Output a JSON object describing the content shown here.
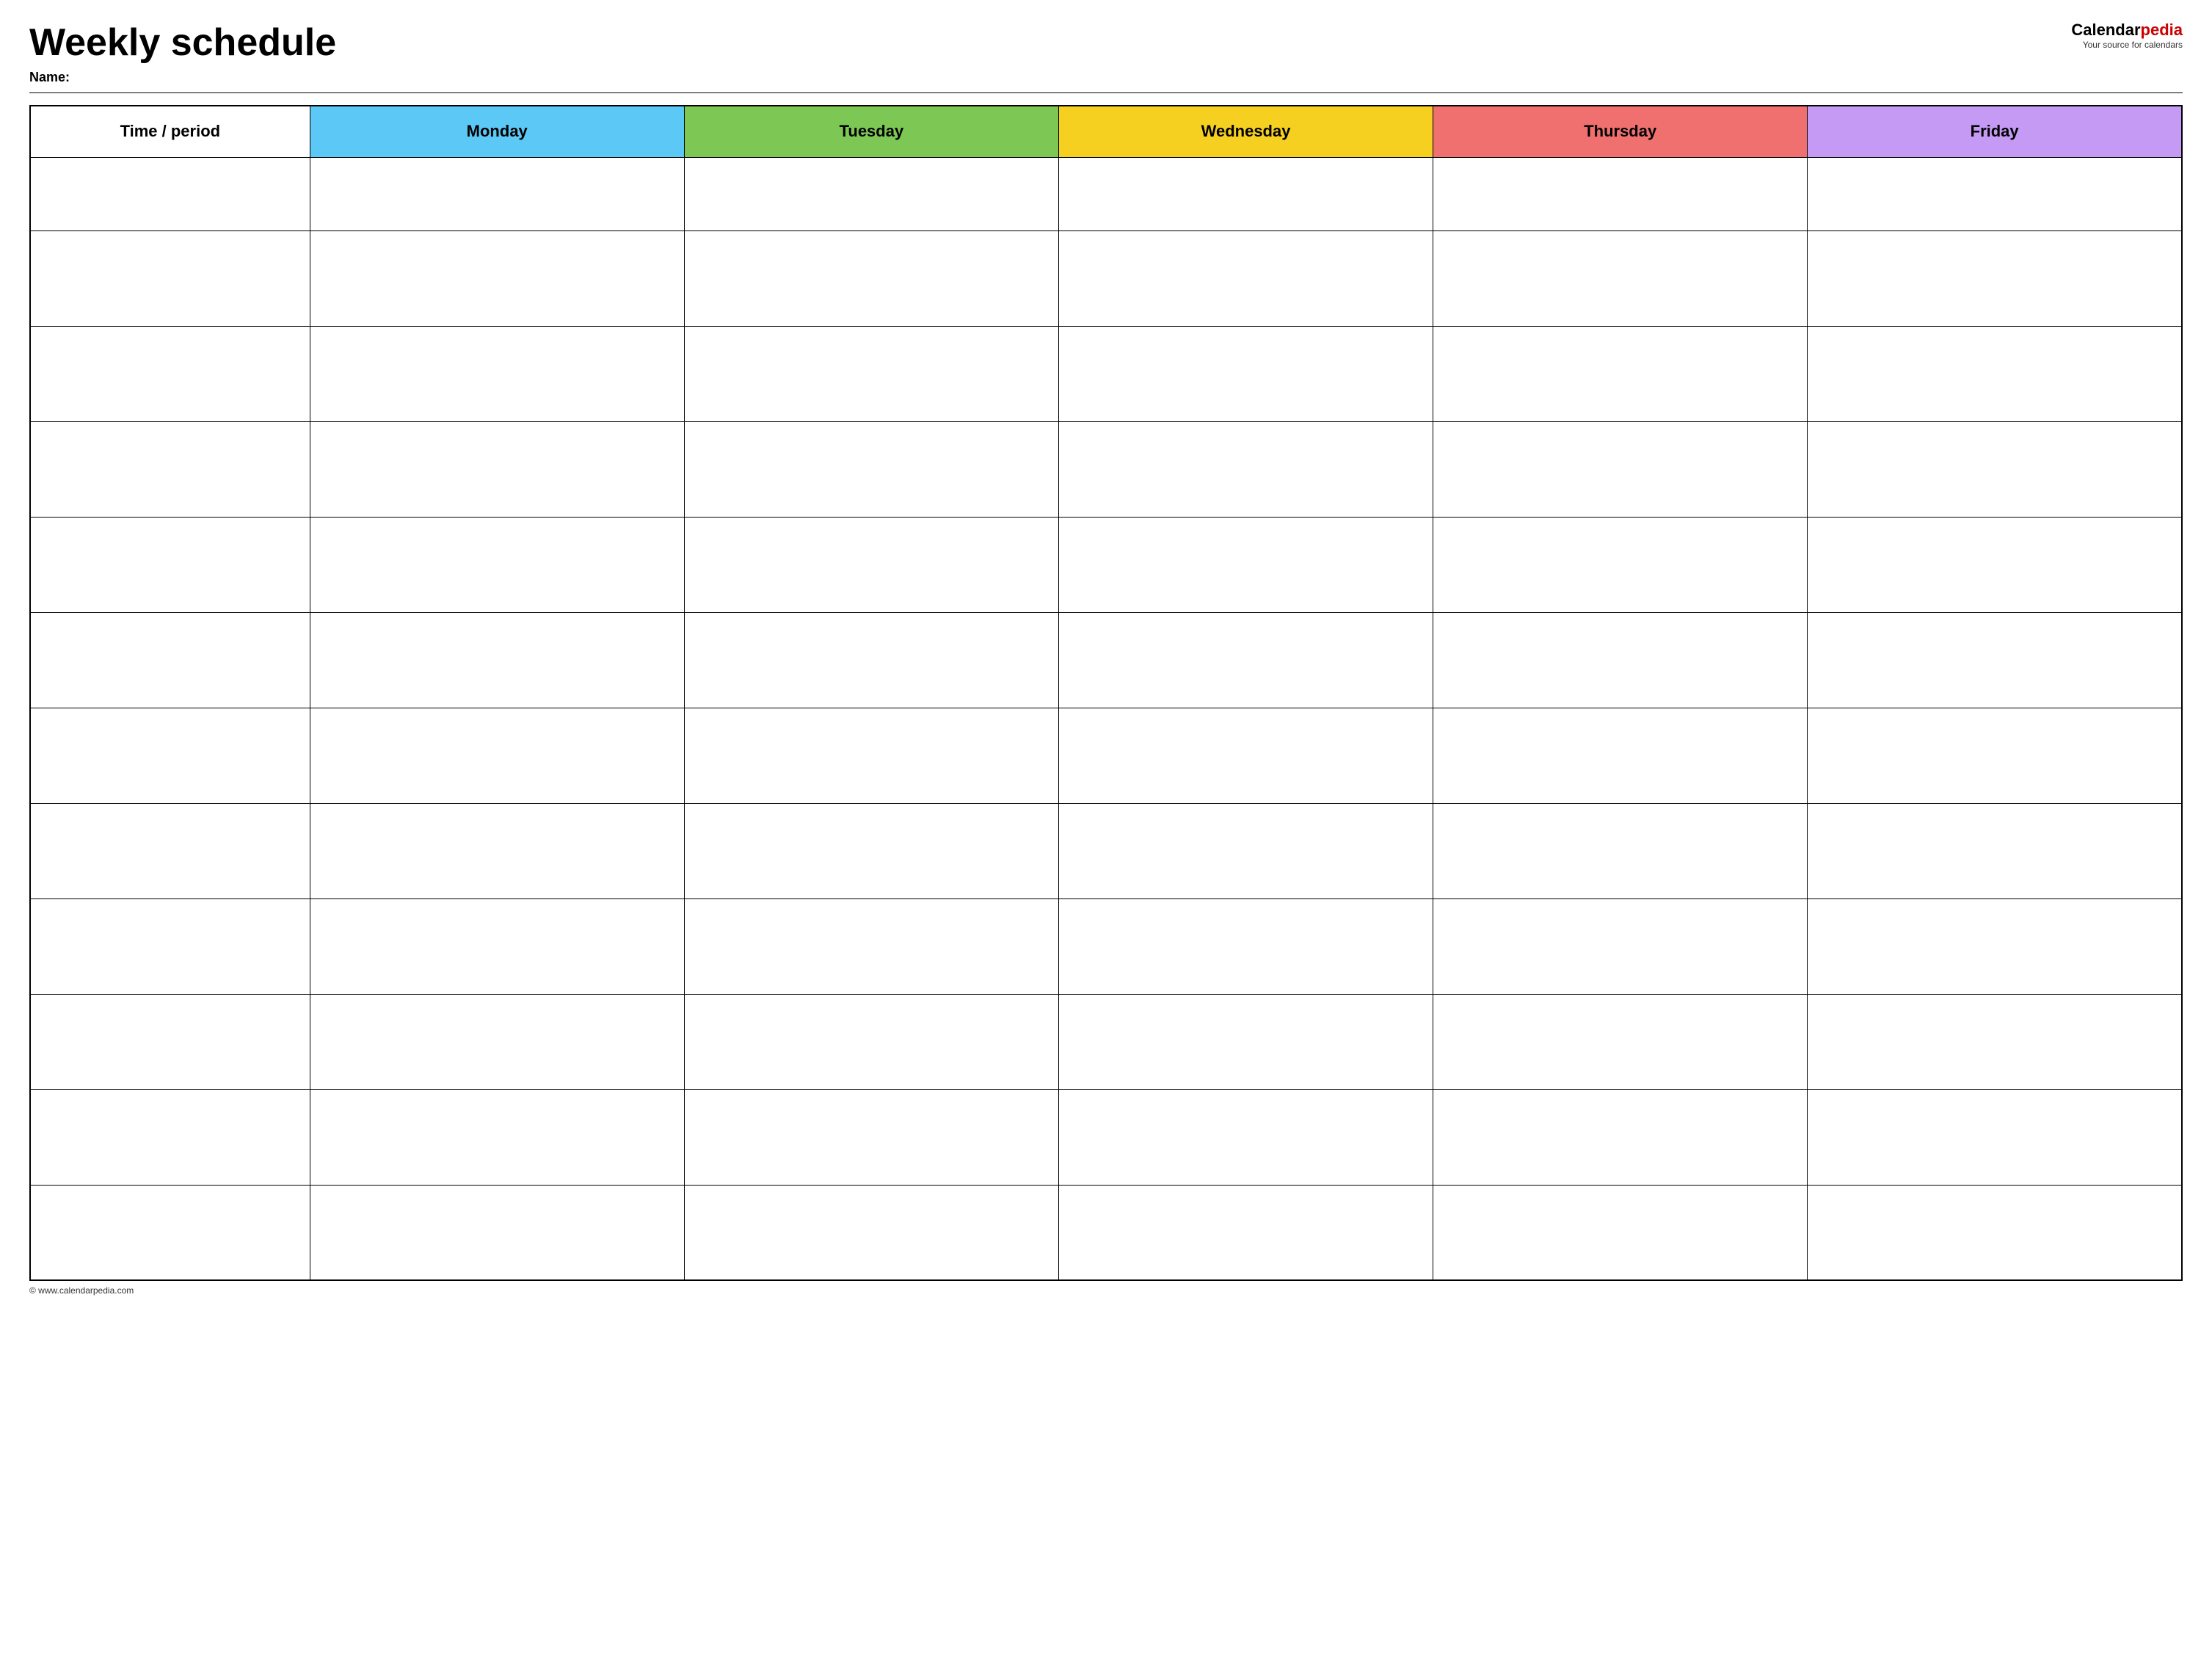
{
  "header": {
    "title": "Weekly schedule",
    "name_label": "Name:",
    "logo_calendar": "Calendar",
    "logo_pedia": "pedia",
    "logo_tagline": "Your source for calendars"
  },
  "table": {
    "columns": [
      {
        "id": "time",
        "label": "Time / period",
        "color": "#ffffff",
        "text_color": "#000000"
      },
      {
        "id": "monday",
        "label": "Monday",
        "color": "#5bc8f5",
        "text_color": "#000000"
      },
      {
        "id": "tuesday",
        "label": "Tuesday",
        "color": "#7dc855",
        "text_color": "#000000"
      },
      {
        "id": "wednesday",
        "label": "Wednesday",
        "color": "#f5d020",
        "text_color": "#000000"
      },
      {
        "id": "thursday",
        "label": "Thursday",
        "color": "#f07070",
        "text_color": "#000000"
      },
      {
        "id": "friday",
        "label": "Friday",
        "color": "#c59af5",
        "text_color": "#000000"
      }
    ],
    "rows": 12
  },
  "footer": {
    "url": "© www.calendarpedia.com"
  }
}
